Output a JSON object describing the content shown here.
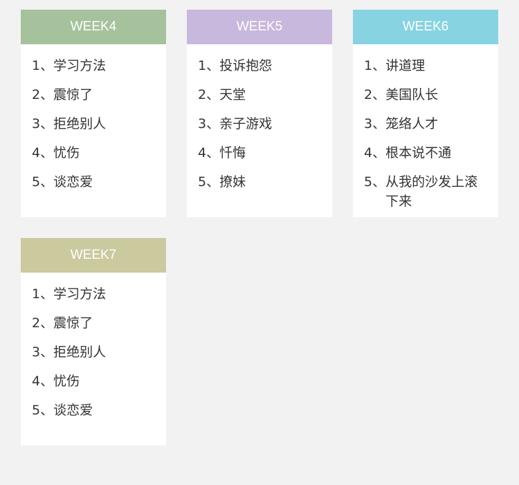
{
  "cards": [
    {
      "title": "WEEK4",
      "color": "#a5c29c",
      "items": [
        {
          "num": "1、",
          "text": "学习方法"
        },
        {
          "num": "2、",
          "text": "震惊了"
        },
        {
          "num": "3、",
          "text": "拒绝别人"
        },
        {
          "num": "4、",
          "text": "忧伤"
        },
        {
          "num": "5、",
          "text": "谈恋爱"
        }
      ]
    },
    {
      "title": "WEEK5",
      "color": "#c8b8dd",
      "items": [
        {
          "num": "1、",
          "text": "投诉抱怨"
        },
        {
          "num": "2、",
          "text": "天堂"
        },
        {
          "num": "3、",
          "text": "亲子游戏"
        },
        {
          "num": "4、",
          "text": "忏悔"
        },
        {
          "num": "5、",
          "text": "撩妹"
        }
      ]
    },
    {
      "title": "WEEK6",
      "color": "#87d3e1",
      "items": [
        {
          "num": "1、",
          "text": "讲道理"
        },
        {
          "num": "2、",
          "text": "美国队长"
        },
        {
          "num": "3、",
          "text": "笼络人才"
        },
        {
          "num": "4、",
          "text": "根本说不通"
        },
        {
          "num": "5、",
          "text": "从我的沙发上滚下来"
        }
      ]
    },
    {
      "title": "WEEK7",
      "color": "#cbc99e",
      "items": [
        {
          "num": "1、",
          "text": "学习方法"
        },
        {
          "num": "2、",
          "text": "震惊了"
        },
        {
          "num": "3、",
          "text": "拒绝别人"
        },
        {
          "num": "4、",
          "text": "忧伤"
        },
        {
          "num": "5、",
          "text": "谈恋爱"
        }
      ]
    }
  ]
}
